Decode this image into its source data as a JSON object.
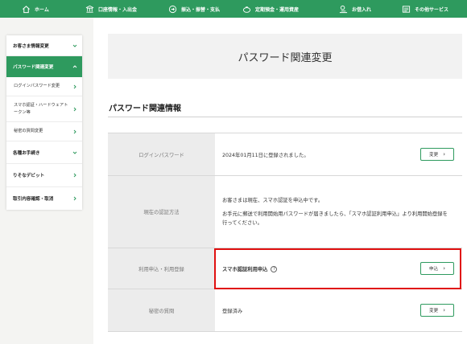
{
  "nav": {
    "items": [
      {
        "label": "ホーム",
        "icon": "home-icon"
      },
      {
        "label": "口座情報・入出金",
        "icon": "bank-icon"
      },
      {
        "label": "振込・振替・支払",
        "icon": "transfer-icon"
      },
      {
        "label": "定期預金・運用資産",
        "icon": "savings-icon"
      },
      {
        "label": "お借入れ",
        "icon": "loan-icon"
      },
      {
        "label": "その他サービス",
        "icon": "services-icon"
      }
    ]
  },
  "sidebar": {
    "items": [
      {
        "label": "お客さま情報変更"
      },
      {
        "label": "パスワード関連変更"
      },
      {
        "label": "ログインパスワード変更"
      },
      {
        "label": "スマホ認証・ハードウェアトークン等"
      },
      {
        "label": "秘密の質問変更"
      },
      {
        "label": "各種お手続き"
      },
      {
        "label": "りそなデビット"
      },
      {
        "label": "取引内容確認・取消"
      }
    ]
  },
  "main": {
    "page_title": "パスワード関連変更",
    "section_title": "パスワード関連情報",
    "rows": [
      {
        "label": "ログインパスワード",
        "value": "2024年01月11日に登録されました。",
        "button": "変更"
      },
      {
        "label": "現在の認証方法",
        "line1": "お客さまは現在、スマホ認証を申込中です。",
        "line2": "お手元に郵送で利用開始用パスワードが届きましたら、「スマホ認証利用申込」より利用開始登録を行ってください。"
      },
      {
        "label": "利用申込・利用登録",
        "value": "スマホ認証利用申込",
        "help": "?",
        "button": "申込"
      },
      {
        "label": "秘密の質問",
        "value": "登録済み",
        "button": "変更"
      }
    ]
  },
  "colors": {
    "brand_green": "#2e9a5e",
    "highlight_red": "#e01010"
  }
}
